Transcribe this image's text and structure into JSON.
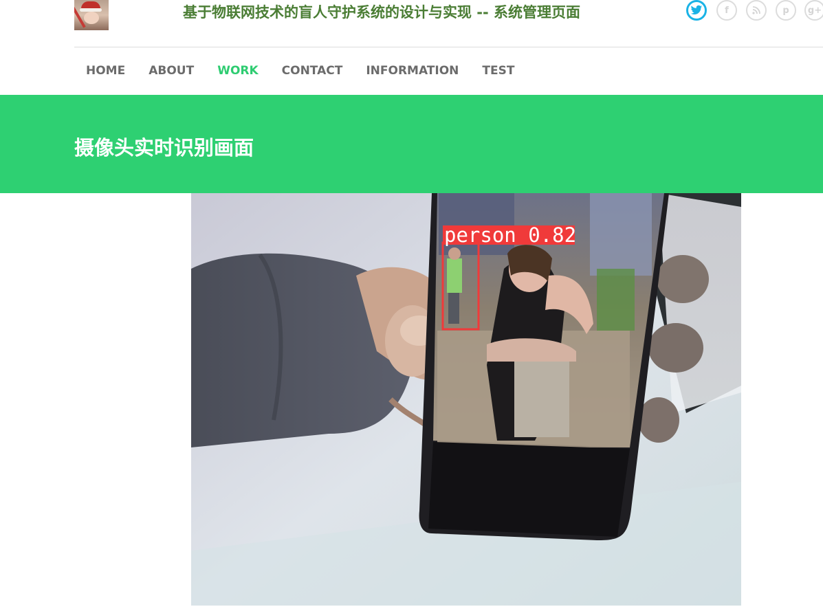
{
  "header": {
    "title": "基于物联网技术的盲人守护系统的设计与实现 -- 系统管理页面",
    "social": [
      {
        "icon": "twitter-icon",
        "glyph": "t"
      },
      {
        "icon": "facebook-icon",
        "glyph": "f"
      },
      {
        "icon": "rss-icon",
        "glyph": "r"
      },
      {
        "icon": "pinterest-icon",
        "glyph": "p"
      },
      {
        "icon": "google-plus-icon",
        "glyph": "g+"
      }
    ]
  },
  "nav": {
    "items": [
      "HOME",
      "ABOUT",
      "WORK",
      "CONTACT",
      "INFORMATION",
      "TEST"
    ],
    "active": "WORK"
  },
  "banner": {
    "title": "摄像头实时识别画面"
  },
  "camera": {
    "detection": {
      "label": "person",
      "confidence": 0.82,
      "text": "person 0.82"
    }
  },
  "colors": {
    "accent": "#2ed072",
    "title": "#4a7d34",
    "nav": "#6b6b6b",
    "detection_box": "#f03a3a"
  }
}
